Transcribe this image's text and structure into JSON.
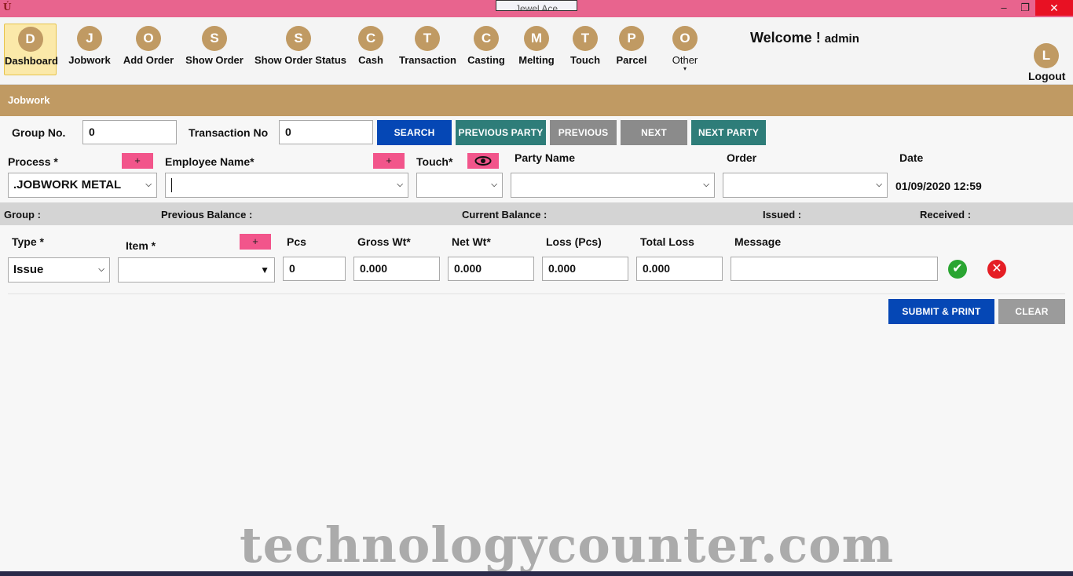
{
  "window": {
    "title": "Jewel Ace",
    "minimize_glyph": "–",
    "restore_glyph": "❐",
    "close_glyph": "✕"
  },
  "nav": [
    {
      "letter": "D",
      "label": "Dashboard",
      "active": true
    },
    {
      "letter": "J",
      "label": "Jobwork"
    },
    {
      "letter": "O",
      "label": "Add Order"
    },
    {
      "letter": "S",
      "label": "Show Order"
    },
    {
      "letter": "S",
      "label": "Show Order Status"
    },
    {
      "letter": "C",
      "label": "Cash"
    },
    {
      "letter": "T",
      "label": "Transaction"
    },
    {
      "letter": "C",
      "label": "Casting"
    },
    {
      "letter": "M",
      "label": "Melting"
    },
    {
      "letter": "T",
      "label": "Touch"
    },
    {
      "letter": "P",
      "label": "Parcel"
    },
    {
      "letter": "O",
      "label": "Other",
      "caret": "▾"
    }
  ],
  "welcome": {
    "text": "Welcome !",
    "user": "admin"
  },
  "logout": {
    "letter": "L",
    "label": "Logout"
  },
  "section": {
    "title": "Jobwork"
  },
  "search_row": {
    "group_no_label": "Group No.",
    "group_no_value": "0",
    "transaction_no_label": "Transaction No",
    "transaction_no_value": "0",
    "search_button": "SEARCH",
    "previous_party_button": "PREVIOUS PARTY",
    "previous_button": "PREVIOUS",
    "next_button": "NEXT",
    "next_party_button": "NEXT PARTY"
  },
  "form_row": {
    "process_label": "Process *",
    "process_value": ".JOBWORK METAL",
    "add_glyph": "+",
    "employee_label": "Employee Name*",
    "employee_value": "",
    "touch_label": "Touch*",
    "touch_value": "",
    "party_label": "Party Name",
    "party_value": "",
    "order_label": "Order",
    "order_value": "",
    "date_label": "Date",
    "date_value": "01/09/2020 12:59"
  },
  "balance": {
    "group_label": "Group :",
    "previous_label": "Previous Balance :",
    "current_label": "Current Balance :",
    "issued_label": "Issued :",
    "received_label": "Received :"
  },
  "entry": {
    "type_label": "Type *",
    "type_value": "Issue",
    "item_label": "Item *",
    "item_value": "",
    "pcs_label": "Pcs",
    "pcs_value": "0",
    "gross_label": "Gross Wt*",
    "gross_value": "0.000",
    "net_label": "Net Wt*",
    "net_value": "0.000",
    "loss_label": "Loss (Pcs)",
    "loss_value": "0.000",
    "total_loss_label": "Total Loss",
    "total_loss_value": "0.000",
    "message_label": "Message",
    "message_value": "",
    "ok_glyph": "✔",
    "cancel_glyph": "✕"
  },
  "actions": {
    "submit_print": "SUBMIT & PRINT",
    "clear": "CLEAR"
  },
  "watermark": "technologycounter.com",
  "icons": [
    "app-icon",
    "eye-icon",
    "check-icon",
    "cancel-icon",
    "chevron-down-icon"
  ],
  "colors": {
    "titlebar": "#e8648e",
    "accent": "#c09a63",
    "blue": "#0547b5",
    "teal": "#2e7d79",
    "pink": "#f2558b"
  }
}
